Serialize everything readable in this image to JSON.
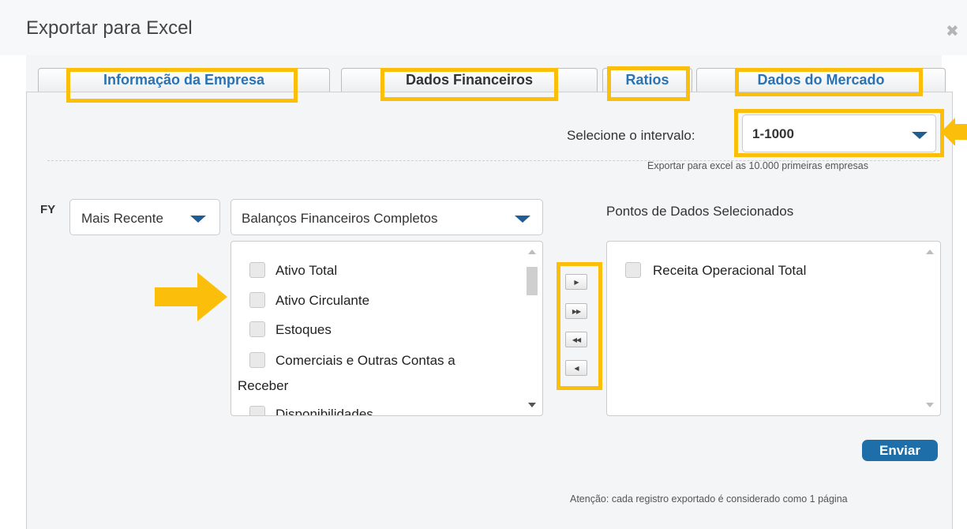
{
  "dialog": {
    "title": "Exportar para Excel",
    "close_icon": "close-icon"
  },
  "tabs": [
    {
      "label": "Informação da Empresa",
      "state": "link"
    },
    {
      "label": "Dados Financeiros",
      "state": "active"
    },
    {
      "label": "Ratios",
      "state": "link"
    },
    {
      "label": "Dados do Mercado",
      "state": "link"
    }
  ],
  "interval": {
    "label": "Selecione o intervalo:",
    "value": "1-1000",
    "note": "Exportar para excel as 10.000 primeiras empresas"
  },
  "fy": {
    "label": "FY",
    "period_value": "Mais Recente",
    "category_value": "Balanços Financeiros Completos"
  },
  "available_items": [
    {
      "label": "Ativo Total",
      "checked": false
    },
    {
      "label": "Ativo Circulante",
      "checked": false
    },
    {
      "label": "Estoques",
      "checked": false
    },
    {
      "label": "Comerciais e Outras Contas a",
      "label2": "Receber",
      "checked": false
    },
    {
      "label": "Disponibilidades",
      "checked": false
    }
  ],
  "selected": {
    "title": "Pontos de Dados Selecionados",
    "items": [
      {
        "label": "Receita Operacional Total",
        "checked": false
      }
    ]
  },
  "move_buttons": [
    {
      "glyph": "▶",
      "icon": "move-right-icon"
    },
    {
      "glyph": "▶▶",
      "icon": "move-all-right-icon"
    },
    {
      "glyph": "◀◀",
      "icon": "move-all-left-icon"
    },
    {
      "glyph": "◀",
      "icon": "move-left-icon"
    }
  ],
  "submit_label": "Enviar",
  "footer_note": "Atenção: cada registro exportado é considerado como 1 página",
  "colors": {
    "highlight": "#fbbf0b",
    "accent": "#1d6ea9",
    "link": "#2a73b5"
  }
}
